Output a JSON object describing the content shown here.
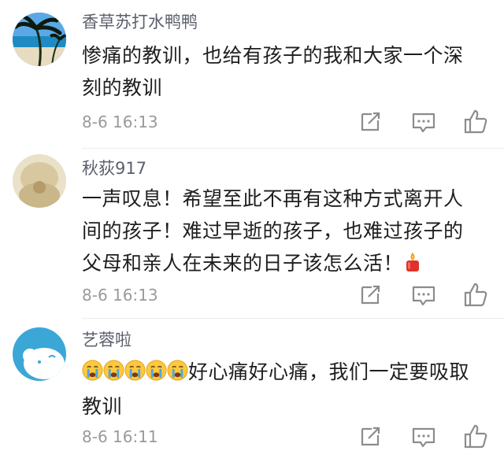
{
  "comments": [
    {
      "username": "香草苏打水鸭鸭",
      "lines": [
        "惨痛的教训，也给有孩子的我和大家一个深",
        "刻的教训"
      ],
      "time": "8-6 16:13"
    },
    {
      "username": "秋荻917",
      "lines": [
        "一声叹息！希望至此不再有这种方式离开人",
        "间的孩子！难过早逝的孩子，也难过孩子的",
        "父母和亲人在未来的日子该怎么活！"
      ],
      "time": "8-6 16:13",
      "trailing_icon": "candle-emoji"
    },
    {
      "username": "艺蓉啦",
      "lines": [
        "好心痛好心痛，我们一定要吸取",
        "教训"
      ],
      "leading_icons": [
        "crying-emoji",
        "crying-emoji",
        "crying-emoji",
        "crying-emoji",
        "crying-emoji"
      ],
      "time": "8-6 16:11"
    }
  ],
  "action_icons": [
    "share-icon",
    "reply-icon",
    "like-icon"
  ],
  "colors": {
    "username": "#5a5f6b",
    "content": "#1e1e1e",
    "time": "#9a9a9a",
    "icon": "#8c8c8c"
  }
}
